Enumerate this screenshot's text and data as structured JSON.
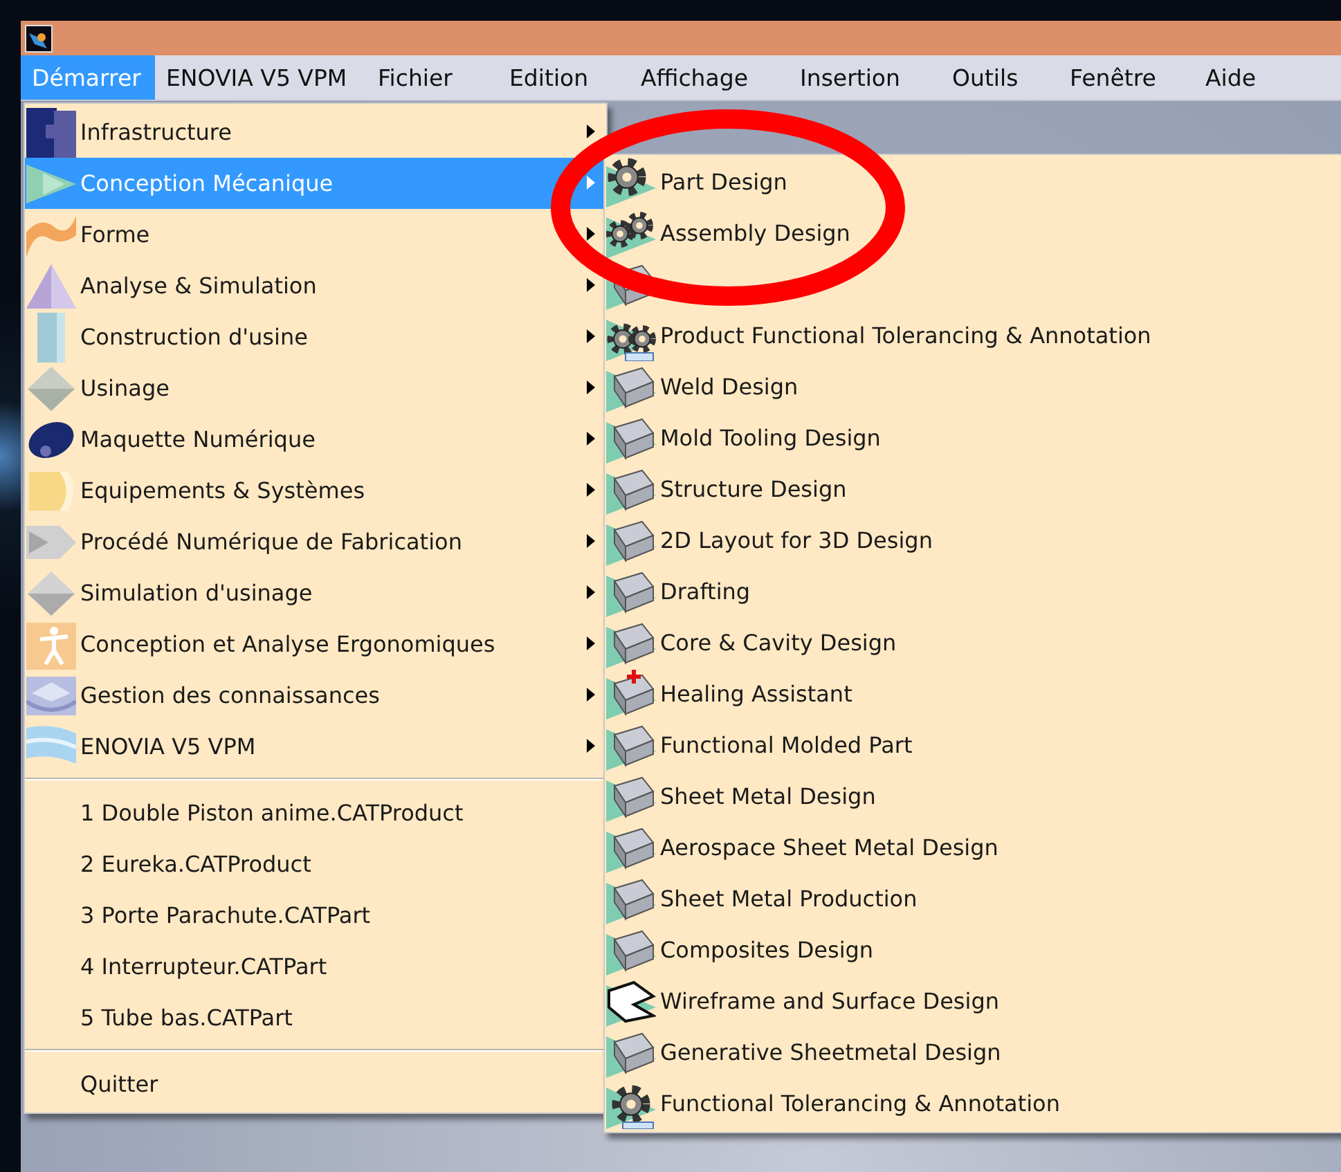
{
  "menu_bar": [
    {
      "label": "Démarrer",
      "selected": true
    },
    {
      "label": "ENOVIA V5 VPM",
      "selected": false
    },
    {
      "label": "Fichier",
      "selected": false
    },
    {
      "label": "Edition",
      "selected": false
    },
    {
      "label": "Affichage",
      "selected": false
    },
    {
      "label": "Insertion",
      "selected": false
    },
    {
      "label": "Outils",
      "selected": false
    },
    {
      "label": "Fenêtre",
      "selected": false
    },
    {
      "label": "Aide",
      "selected": false
    }
  ],
  "start_menu": [
    {
      "kind": "submenu",
      "label": "Infrastructure",
      "selected": false
    },
    {
      "kind": "submenu",
      "label": "Conception Mécanique",
      "selected": true
    },
    {
      "kind": "submenu",
      "label": "Forme",
      "selected": false
    },
    {
      "kind": "submenu",
      "label": "Analyse & Simulation",
      "selected": false
    },
    {
      "kind": "submenu",
      "label": "Construction d'usine",
      "selected": false
    },
    {
      "kind": "submenu",
      "label": "Usinage",
      "selected": false
    },
    {
      "kind": "submenu",
      "label": "Maquette Numérique",
      "selected": false
    },
    {
      "kind": "submenu",
      "label": "Equipements & Systèmes",
      "selected": false
    },
    {
      "kind": "submenu",
      "label": "Procédé Numérique de Fabrication",
      "selected": false
    },
    {
      "kind": "submenu",
      "label": "Simulation d'usinage",
      "selected": false
    },
    {
      "kind": "submenu",
      "label": "Conception et Analyse Ergonomiques",
      "selected": false
    },
    {
      "kind": "submenu",
      "label": "Gestion des connaissances",
      "selected": false
    },
    {
      "kind": "submenu",
      "label": "ENOVIA V5 VPM",
      "selected": false
    },
    {
      "kind": "separator"
    },
    {
      "kind": "file",
      "label": "1 Double Piston anime.CATProduct",
      "selected": false
    },
    {
      "kind": "file",
      "label": "2 Eureka.CATProduct",
      "selected": false
    },
    {
      "kind": "file",
      "label": "3 Porte Parachute.CATPart",
      "selected": false
    },
    {
      "kind": "file",
      "label": "4 Interrupteur.CATPart",
      "selected": false
    },
    {
      "kind": "file",
      "label": "5 Tube bas.CATPart",
      "selected": false
    },
    {
      "kind": "separator"
    },
    {
      "kind": "command",
      "label": "Quitter",
      "selected": false
    }
  ],
  "submenu": [
    {
      "label": "Part Design",
      "selected": false
    },
    {
      "label": "Assembly Design",
      "selected": false
    },
    {
      "selected": false
    },
    {
      "label": "Product Functional Tolerancing & Annotation",
      "selected": false
    },
    {
      "label": "Weld Design",
      "selected": false
    },
    {
      "label": "Mold Tooling Design",
      "selected": false
    },
    {
      "label": "Structure Design",
      "selected": false
    },
    {
      "label": "2D Layout for 3D Design",
      "selected": false
    },
    {
      "label": "Drafting",
      "selected": false
    },
    {
      "label": "Core & Cavity Design",
      "selected": false
    },
    {
      "label": "Healing Assistant",
      "selected": false
    },
    {
      "label": "Functional Molded Part",
      "selected": false
    },
    {
      "label": "Sheet Metal Design",
      "selected": false
    },
    {
      "label": "Aerospace Sheet Metal  Design",
      "selected": false
    },
    {
      "label": "Sheet Metal Production",
      "selected": false
    },
    {
      "label": "Composites Design",
      "selected": false
    },
    {
      "label": "Wireframe and Surface Design",
      "selected": false
    },
    {
      "label": "Generative Sheetmetal Design",
      "selected": false
    },
    {
      "label": "Functional Tolerancing & Annotation",
      "selected": false
    }
  ]
}
